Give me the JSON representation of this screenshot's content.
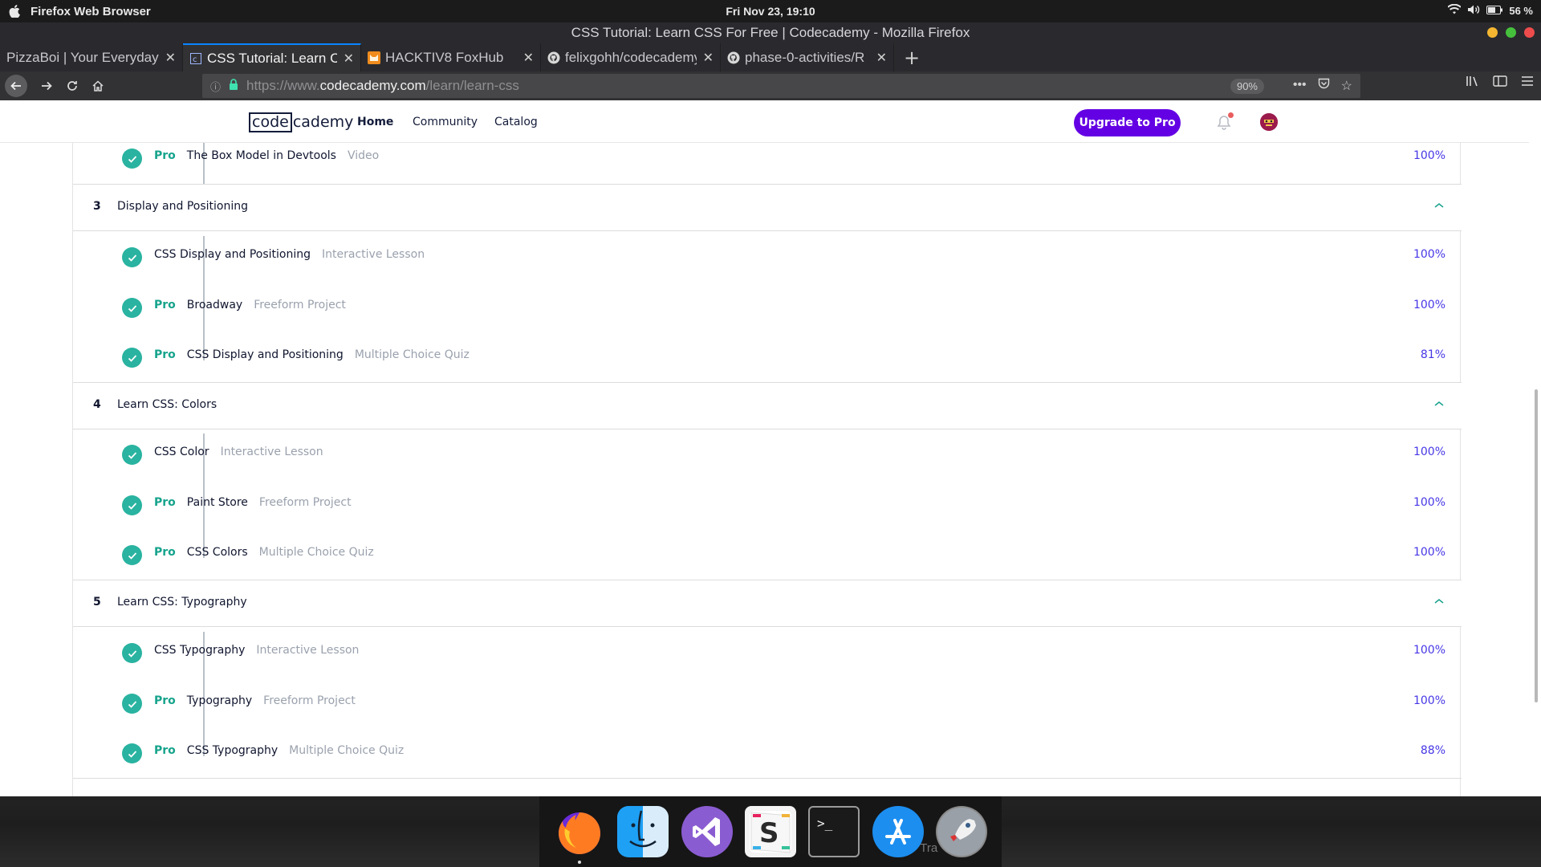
{
  "os": {
    "app_name": "Firefox Web Browser",
    "clock": "Fri Nov 23, 19:10",
    "battery": "56 %"
  },
  "window": {
    "title": "CSS Tutorial: Learn CSS For Free | Codecademy - Mozilla Firefox"
  },
  "tabs": [
    {
      "label": "PizzaBoi | Your Everyday Pizza",
      "icon": "none"
    },
    {
      "label": "CSS Tutorial: Learn CSS For Free",
      "icon": "codecademy-icon"
    },
    {
      "label": "HACKTIV8 FoxHub",
      "icon": "foxhub-icon"
    },
    {
      "label": "felixgohh/codecademy",
      "icon": "github-icon"
    },
    {
      "label": "phase-0-activities/R",
      "icon": "github-icon"
    }
  ],
  "urlbar": {
    "prefix": "https://www.",
    "domain": "codecademy.com",
    "path": "/learn/learn-css",
    "zoom": "90%"
  },
  "header": {
    "logo_box": "code",
    "logo_rest": "cademy",
    "nav": [
      "Home",
      "Community",
      "Catalog"
    ],
    "upgrade_label": "Upgrade to Pro"
  },
  "syllabus": {
    "top_item": {
      "pro": "Pro",
      "name": "The Box Model in Devtools",
      "meta": "Video",
      "pct": "100%"
    },
    "sections": [
      {
        "num": "3",
        "name": "Display and Positioning",
        "items": [
          {
            "pro": "",
            "name": "CSS Display and Positioning",
            "meta": "Interactive Lesson",
            "pct": "100%"
          },
          {
            "pro": "Pro",
            "name": "Broadway",
            "meta": "Freeform Project",
            "pct": "100%"
          },
          {
            "pro": "Pro",
            "name": "CSS Display and Positioning",
            "meta": "Multiple Choice Quiz",
            "pct": "81%"
          }
        ]
      },
      {
        "num": "4",
        "name": "Learn CSS: Colors",
        "items": [
          {
            "pro": "",
            "name": "CSS Color",
            "meta": "Interactive Lesson",
            "pct": "100%"
          },
          {
            "pro": "Pro",
            "name": "Paint Store",
            "meta": "Freeform Project",
            "pct": "100%"
          },
          {
            "pro": "Pro",
            "name": "CSS Colors",
            "meta": "Multiple Choice Quiz",
            "pct": "100%"
          }
        ]
      },
      {
        "num": "5",
        "name": "Learn CSS: Typography",
        "items": [
          {
            "pro": "",
            "name": "CSS Typography",
            "meta": "Interactive Lesson",
            "pct": "100%"
          },
          {
            "pro": "Pro",
            "name": "Typography",
            "meta": "Freeform Project",
            "pct": "100%"
          },
          {
            "pro": "Pro",
            "name": "CSS Typography",
            "meta": "Multiple Choice Quiz",
            "pct": "88%"
          }
        ]
      }
    ]
  },
  "dock": {
    "apps": [
      "firefox-icon",
      "finder-icon",
      "visual-studio-icon",
      "slack-icon",
      "terminal-icon",
      "app-store-icon",
      "launchpad-icon"
    ],
    "trash_label": "Tra"
  },
  "colors": {
    "accent_purple": "#6400e4",
    "pro_green": "#16a38c",
    "check_teal": "#29b3a0",
    "percent_blue": "#4637e6"
  }
}
